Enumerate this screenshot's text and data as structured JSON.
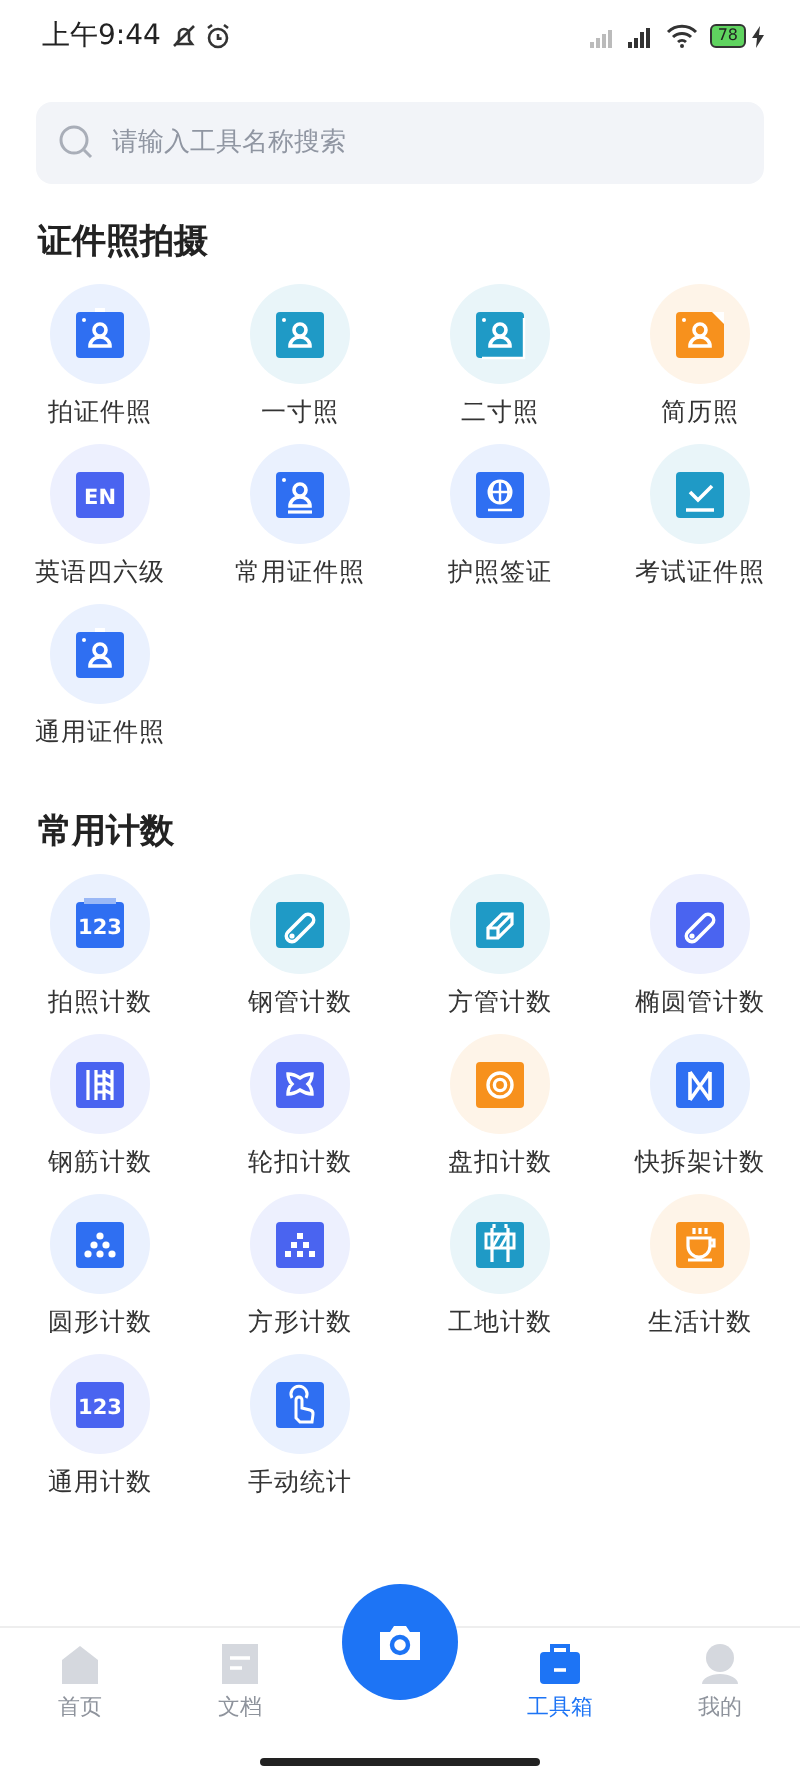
{
  "status_bar": {
    "time": "上午9:44",
    "battery": "78"
  },
  "search": {
    "placeholder": "请输入工具名称搜索"
  },
  "sections": [
    {
      "title": "证件照拍摄",
      "tools": [
        {
          "label": "拍证件照",
          "kind": "badge",
          "color": "#2f6ff2"
        },
        {
          "label": "一寸照",
          "kind": "person",
          "color": "#1f9ac6"
        },
        {
          "label": "二寸照",
          "kind": "stack",
          "color": "#1f9ac6"
        },
        {
          "label": "简历照",
          "kind": "doc",
          "color": "#f7911d"
        },
        {
          "label": "英语四六级",
          "kind": "text",
          "glyph": "EN",
          "color": "#4a64f0"
        },
        {
          "label": "常用证件照",
          "kind": "card",
          "color": "#2f6ff2"
        },
        {
          "label": "护照签证",
          "kind": "globe",
          "color": "#2f6ff2"
        },
        {
          "label": "考试证件照",
          "kind": "check",
          "color": "#1f9ac6"
        },
        {
          "label": "通用证件照",
          "kind": "badge",
          "color": "#2f6ff2"
        }
      ]
    },
    {
      "title": "常用计数",
      "tools": [
        {
          "label": "拍照计数",
          "kind": "tabbed",
          "glyph": "123",
          "color": "#2f6ff2"
        },
        {
          "label": "钢管计数",
          "kind": "pipe",
          "color": "#1f9ac6"
        },
        {
          "label": "方管计数",
          "kind": "tube",
          "color": "#1f9ac6"
        },
        {
          "label": "椭圆管计数",
          "kind": "pipe",
          "color": "#4a64f0"
        },
        {
          "label": "钢筋计数",
          "kind": "rebar",
          "color": "#4a64f0"
        },
        {
          "label": "轮扣计数",
          "kind": "buckle",
          "color": "#4a64f0"
        },
        {
          "label": "盘扣计数",
          "kind": "disc",
          "color": "#f7911d"
        },
        {
          "label": "快拆架计数",
          "kind": "scaffold",
          "color": "#2f6ff2"
        },
        {
          "label": "圆形计数",
          "kind": "dots",
          "color": "#2f6ff2"
        },
        {
          "label": "方形计数",
          "kind": "squares",
          "color": "#4a64f0"
        },
        {
          "label": "工地计数",
          "kind": "barrier",
          "color": "#1f9ac6"
        },
        {
          "label": "生活计数",
          "kind": "cup",
          "color": "#f7911d"
        },
        {
          "label": "通用计数",
          "kind": "text",
          "glyph": "123",
          "color": "#4a64f0"
        },
        {
          "label": "手动统计",
          "kind": "hand",
          "color": "#2f6ff2"
        }
      ]
    }
  ],
  "nav": [
    {
      "kind": "home",
      "label": "首页",
      "selected": false
    },
    {
      "kind": "doc",
      "label": "文档",
      "selected": false
    },
    {
      "kind": "camera"
    },
    {
      "kind": "toolbox",
      "label": "工具箱",
      "selected": true
    },
    {
      "kind": "profile",
      "label": "我的",
      "selected": false
    }
  ]
}
